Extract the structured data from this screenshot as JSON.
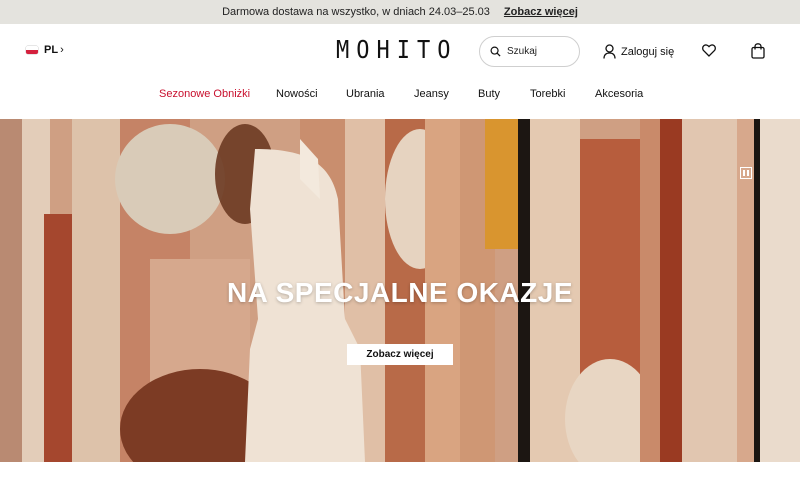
{
  "promo": {
    "message": "Darmowa dostawa na wszystko, w dniach 24.03–25.03",
    "link": "Zobacz więcej"
  },
  "header": {
    "language": "PL",
    "logo": "MOHITO",
    "search_label": "Szukaj",
    "login_label": "Zaloguj się"
  },
  "nav": {
    "items": [
      "Sezonowe Obniżki",
      "Nowości",
      "Ubrania",
      "Jeansy",
      "Buty",
      "Torebki",
      "Akcesoria"
    ]
  },
  "hero": {
    "title": "NA SPECJALNE OKAZJE",
    "button_label": "Zobacz więcej"
  },
  "colors": {
    "promo_bg": "#e4e3de",
    "sale_red": "#c8102e",
    "text": "#111111"
  },
  "icons": [
    "flag-pl-icon",
    "chevron-right-icon",
    "search-icon",
    "user-icon",
    "heart-icon",
    "bag-icon",
    "pause-icon"
  ]
}
